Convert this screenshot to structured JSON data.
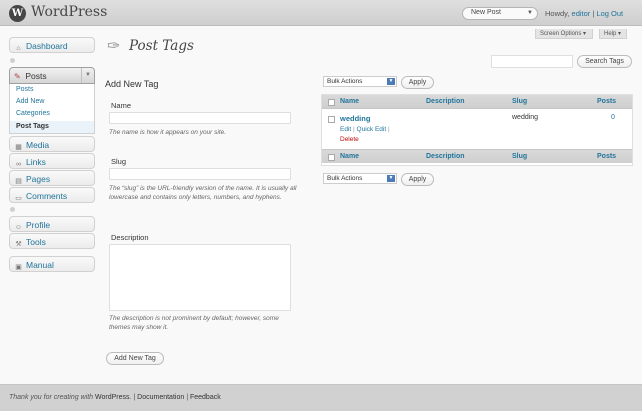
{
  "header": {
    "logo_glyph": "W",
    "site_title": "WordPress",
    "favorite_action": "New Post",
    "howdy": "Howdy, ",
    "username": "editor",
    "logout": "Log Out",
    "divider": "|"
  },
  "screen_meta": {
    "options": "Screen Options ▾",
    "help": "Help ▾"
  },
  "sidebar": {
    "dashboard": "Dashboard",
    "posts": "Posts",
    "posts_sub": [
      "Posts",
      "Add New",
      "Categories",
      "Post Tags"
    ],
    "media": "Media",
    "links": "Links",
    "pages": "Pages",
    "comments": "Comments",
    "profile": "Profile",
    "tools": "Tools",
    "manual": "Manual"
  },
  "page": {
    "title": "Post Tags",
    "search_button": "Search Tags",
    "search_value": ""
  },
  "form": {
    "heading": "Add New Tag",
    "name_label": "Name",
    "name_value": "",
    "name_desc": "The name is how it appears on your site.",
    "slug_label": "Slug",
    "slug_value": "",
    "slug_desc": "The “slug” is the URL-friendly version of the name. It is usually all lowercase and contains only letters, numbers, and hyphens.",
    "description_label": "Description",
    "description_value": "",
    "description_desc": "The description is not prominent by default; however, some themes may show it.",
    "submit": "Add New Tag"
  },
  "bulk": {
    "select": "Bulk Actions",
    "apply": "Apply"
  },
  "table": {
    "columns": [
      "Name",
      "Description",
      "Slug",
      "Posts"
    ],
    "rows": [
      {
        "name": "wedding",
        "description": "",
        "slug": "wedding",
        "posts": "0",
        "actions": {
          "edit": "Edit",
          "quick_edit": "Quick Edit",
          "delete": "Delete",
          "sep": "|"
        }
      }
    ]
  },
  "footer": {
    "thanks": "Thank you for creating with ",
    "wordpress": "WordPress",
    "sep": ".  |  ",
    "documentation": "Documentation",
    "sep2": "  |  ",
    "feedback": "Feedback"
  },
  "colors": {
    "link": "#21759b",
    "delete": "#bc0b0b",
    "header_bg": "#d4d4d4"
  }
}
